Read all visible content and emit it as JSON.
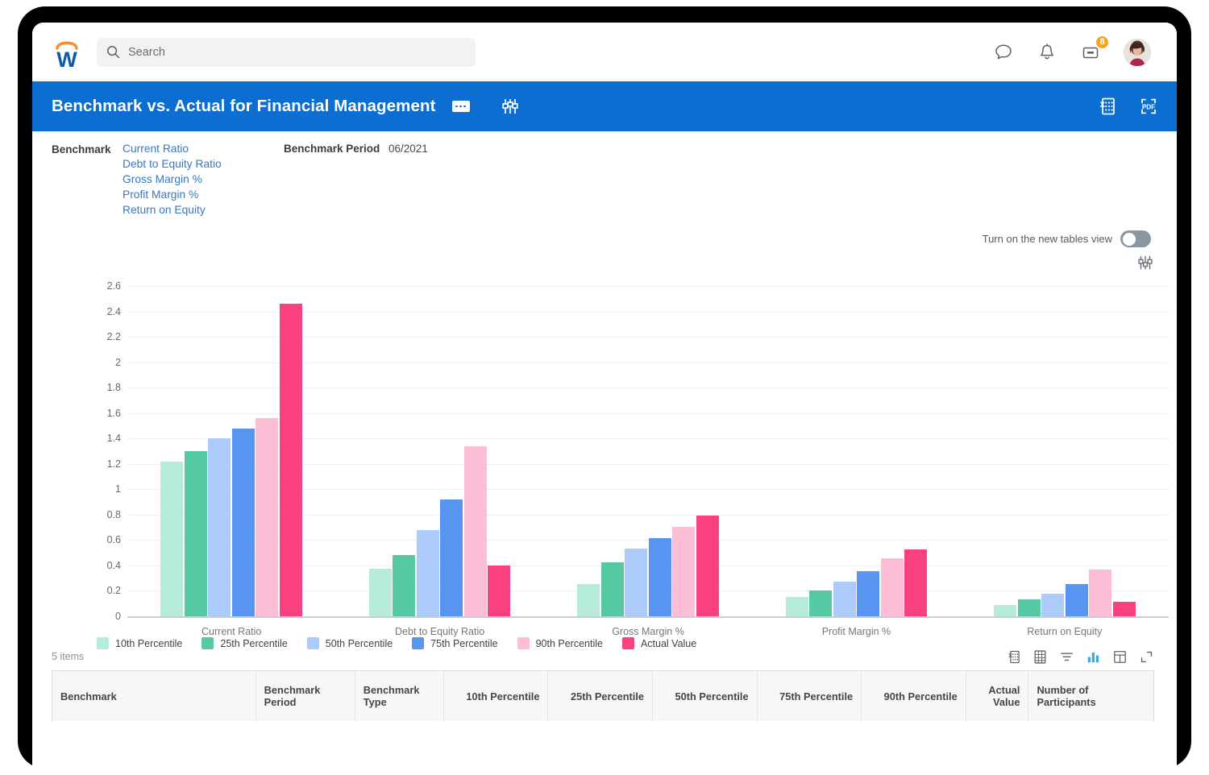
{
  "topbar": {
    "logo_name": "workday-logo",
    "search": {
      "placeholder": "Search",
      "value": ""
    },
    "icons": [
      {
        "name": "chat-icon",
        "label": "Chat"
      },
      {
        "name": "bell-icon",
        "label": "Notifications"
      },
      {
        "name": "inbox-icon",
        "label": "Inbox",
        "badge": "8"
      }
    ],
    "avatar_label": "User profile"
  },
  "titlebar": {
    "title": "Benchmark vs. Actual for Financial Management",
    "more_label": "More actions",
    "filter_label": "Chart options",
    "export_excel_label": "Export to Excel",
    "export_pdf_label": "Export to PDF"
  },
  "filters": {
    "benchmark_label": "Benchmark",
    "benchmark_items": [
      "Current Ratio",
      "Debt to Equity Ratio",
      "Gross Margin %",
      "Profit Margin %",
      "Return on Equity"
    ],
    "period_label": "Benchmark Period",
    "period_value": "06/2021"
  },
  "tables_toggle": {
    "label": "Turn on the new tables view",
    "state": "off"
  },
  "chart_data": {
    "type": "bar",
    "title": "",
    "xlabel": "",
    "ylabel": "",
    "grid": true,
    "legend_position": "bottom",
    "ylim": [
      0,
      2.6
    ],
    "yticks": [
      "0",
      "0.2",
      "0.4",
      "0.6",
      "0.8",
      "1",
      "1.2",
      "1.4",
      "1.6",
      "1.8",
      "2",
      "2.2",
      "2.4",
      "2.6"
    ],
    "categories": [
      "Current Ratio",
      "Debt to Equity Ratio",
      "Gross Margin %",
      "Profit Margin %",
      "Return on Equity"
    ],
    "series": [
      {
        "name": "10th Percentile",
        "color": "#b5ebd7",
        "values": [
          1.22,
          0.375,
          0.255,
          0.155,
          0.09
        ]
      },
      {
        "name": "25th Percentile",
        "color": "#56c9a4",
        "values": [
          1.3,
          0.485,
          0.425,
          0.2,
          0.135
        ]
      },
      {
        "name": "50th Percentile",
        "color": "#abccfb",
        "values": [
          1.4,
          0.68,
          0.535,
          0.27,
          0.175
        ]
      },
      {
        "name": "75th Percentile",
        "color": "#5795f0",
        "values": [
          1.48,
          0.92,
          0.615,
          0.355,
          0.255
        ]
      },
      {
        "name": "90th Percentile",
        "color": "#fcbdd7",
        "values": [
          1.56,
          1.335,
          0.705,
          0.455,
          0.37
        ]
      },
      {
        "name": "Actual Value",
        "color": "#f9417d",
        "values": [
          2.46,
          0.4,
          0.79,
          0.525,
          0.115
        ]
      }
    ]
  },
  "table": {
    "items_count": "5 items",
    "tools": [
      {
        "name": "export-excel-icon",
        "label": "Export to Excel"
      },
      {
        "name": "grid-view-icon",
        "label": "Grid view"
      },
      {
        "name": "filter-icon",
        "label": "Filter"
      },
      {
        "name": "chart-view-icon",
        "label": "Chart view",
        "active": true
      },
      {
        "name": "table-view-icon",
        "label": "Table view"
      },
      {
        "name": "expand-icon",
        "label": "Expand"
      }
    ],
    "columns": [
      {
        "label": "Benchmark",
        "align": "l"
      },
      {
        "label": "Benchmark Period",
        "align": "l"
      },
      {
        "label": "Benchmark Type",
        "align": "l"
      },
      {
        "label": "10th Percentile",
        "align": "r"
      },
      {
        "label": "25th Percentile",
        "align": "r"
      },
      {
        "label": "50th Percentile",
        "align": "r"
      },
      {
        "label": "75th Percentile",
        "align": "r"
      },
      {
        "label": "90th Percentile",
        "align": "r"
      },
      {
        "label": "Actual Value",
        "align": "r"
      },
      {
        "label": "Number of Participants",
        "align": "l"
      }
    ]
  },
  "colors": {
    "brand_blue": "#0b6ed0",
    "link_blue": "#3778c2",
    "accent_orange": "#f5a623"
  }
}
